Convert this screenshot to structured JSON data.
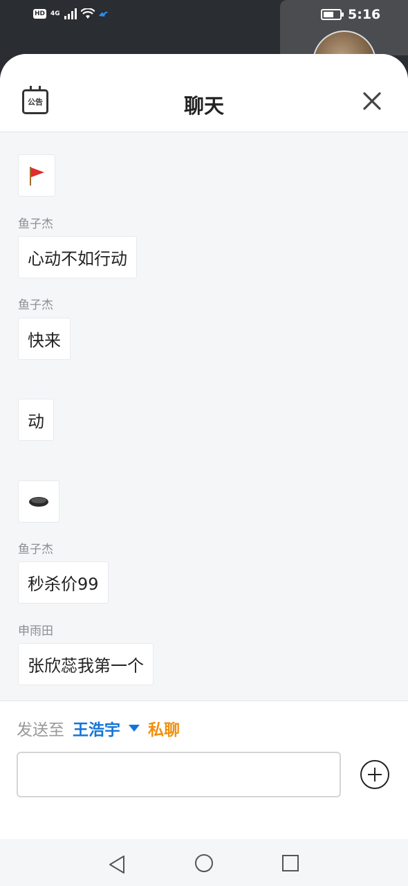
{
  "status_bar": {
    "hd": "HD",
    "network": "4G",
    "time": "5:16"
  },
  "header": {
    "notice_label": "公告",
    "title": "聊天"
  },
  "messages": [
    {
      "sender": "",
      "text": "🚩"
    },
    {
      "sender": "鱼子杰",
      "text": "心动不如行动"
    },
    {
      "sender": "鱼子杰",
      "text": "快来"
    },
    {
      "sender": "",
      "text": "动"
    },
    {
      "sender": "",
      "text": "⬬"
    },
    {
      "sender": "鱼子杰",
      "text": "秒杀价99"
    },
    {
      "sender": "申雨田",
      "text": "张欣蕊我第一个"
    }
  ],
  "footer": {
    "send_to_label": "发送至",
    "recipient": "王浩宇",
    "mode": "私聊",
    "input_value": "",
    "input_placeholder": ""
  },
  "colors": {
    "recipient": "#1574d8",
    "mode": "#f0900f",
    "background": "#f5f6f8"
  }
}
